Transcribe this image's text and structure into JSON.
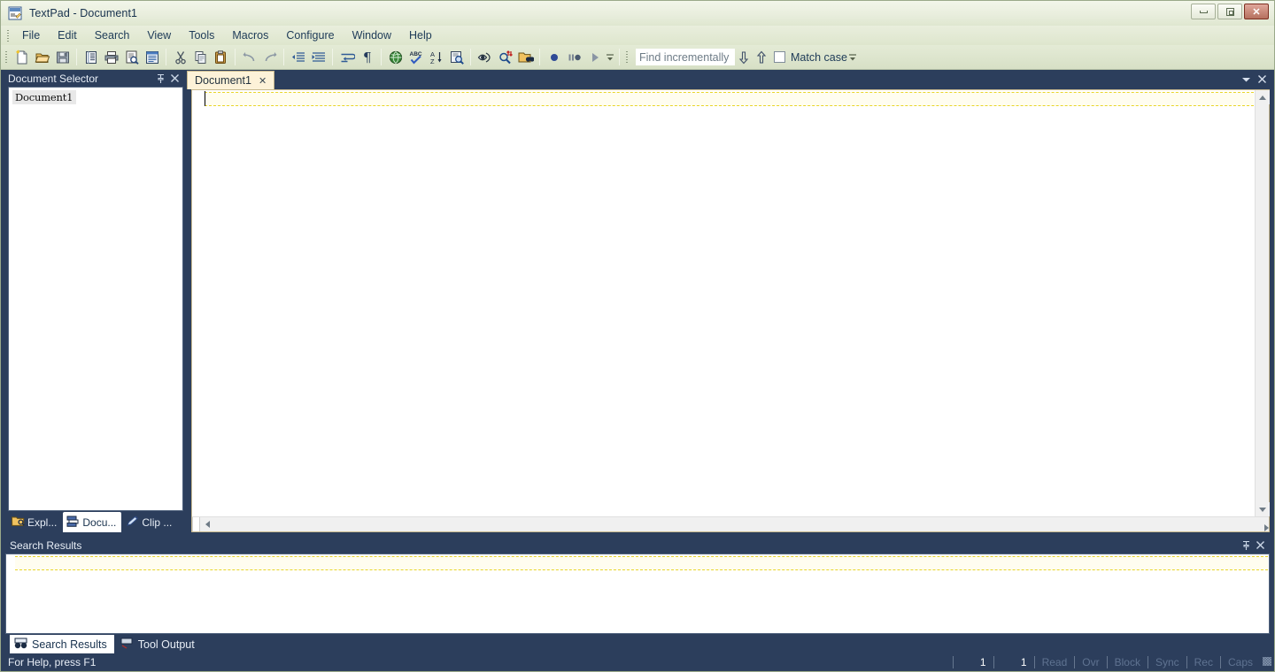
{
  "window": {
    "title": "TextPad - Document1",
    "app_icon": "textpad-app-icon",
    "controls": {
      "minimize": "minimize-button",
      "restore": "restore-button",
      "close_label": "✕"
    }
  },
  "menubar": {
    "items": [
      {
        "label": "File"
      },
      {
        "label": "Edit"
      },
      {
        "label": "Search"
      },
      {
        "label": "View"
      },
      {
        "label": "Tools"
      },
      {
        "label": "Macros"
      },
      {
        "label": "Configure"
      },
      {
        "label": "Window"
      },
      {
        "label": "Help"
      }
    ]
  },
  "toolbar": {
    "buttons": [
      {
        "name": "new-document-icon"
      },
      {
        "name": "open-file-icon"
      },
      {
        "name": "save-file-icon"
      },
      {
        "name": "separator"
      },
      {
        "name": "document-properties-icon"
      },
      {
        "name": "print-icon"
      },
      {
        "name": "print-preview-icon"
      },
      {
        "name": "page-setup-icon"
      },
      {
        "name": "separator"
      },
      {
        "name": "cut-icon"
      },
      {
        "name": "copy-icon"
      },
      {
        "name": "paste-icon"
      },
      {
        "name": "separator"
      },
      {
        "name": "undo-icon"
      },
      {
        "name": "redo-icon"
      },
      {
        "name": "separator"
      },
      {
        "name": "decrease-indent-icon"
      },
      {
        "name": "increase-indent-icon"
      },
      {
        "name": "separator"
      },
      {
        "name": "word-wrap-icon"
      },
      {
        "name": "show-paragraphs-icon"
      },
      {
        "name": "separator"
      },
      {
        "name": "web-browse-icon"
      },
      {
        "name": "spell-check-icon"
      },
      {
        "name": "sort-lines-icon"
      },
      {
        "name": "find-in-files-icon"
      },
      {
        "name": "separator"
      },
      {
        "name": "view-document-icon"
      },
      {
        "name": "replace-icon"
      },
      {
        "name": "search-folder-icon"
      },
      {
        "name": "separator"
      },
      {
        "name": "record-macro-icon"
      },
      {
        "name": "pause-macro-icon"
      },
      {
        "name": "play-macro-icon"
      }
    ],
    "find": {
      "placeholder": "Find incrementally",
      "value": "",
      "find_next_icon": "arrow-down-icon",
      "find_prev_icon": "arrow-up-icon",
      "match_case_label": "Match case",
      "match_case_checked": false
    },
    "overflow_label": "⏷"
  },
  "document_selector": {
    "title": "Document Selector",
    "pin_icon": "pin-icon",
    "close_icon": "close-icon",
    "items": [
      {
        "label": "Document1"
      }
    ],
    "tabs": [
      {
        "label": "Expl...",
        "icon": "explorer-folder-icon",
        "active": false
      },
      {
        "label": "Docu...",
        "icon": "document-selector-icon",
        "active": true
      },
      {
        "label": "Clip ...",
        "icon": "clip-library-icon",
        "active": false
      }
    ]
  },
  "editor": {
    "tabs": [
      {
        "label": "Document1",
        "close_label": "✕",
        "active": true
      }
    ],
    "tab_menu_icon": "chevron-down-icon",
    "tab_close_icon": "close-icon",
    "content": "",
    "scroll": {
      "up_icon": "scroll-up-arrow",
      "down_icon": "scroll-down-arrow",
      "left_icon": "scroll-left-arrow",
      "right_icon": "scroll-right-arrow"
    }
  },
  "search_results": {
    "title": "Search Results",
    "pin_icon": "pin-icon",
    "close_icon": "close-icon",
    "content": "",
    "tabs": [
      {
        "label": "Search Results",
        "icon": "binoculars-icon",
        "active": true
      },
      {
        "label": "Tool Output",
        "icon": "tool-output-icon",
        "active": false
      }
    ]
  },
  "statusbar": {
    "help_text": "For Help, press F1",
    "line": "1",
    "column": "1",
    "indicators": [
      {
        "label": "Read",
        "active": false
      },
      {
        "label": "Ovr",
        "active": false
      },
      {
        "label": "Block",
        "active": false
      },
      {
        "label": "Sync",
        "active": false
      },
      {
        "label": "Rec",
        "active": false
      },
      {
        "label": "Caps",
        "active": false
      }
    ],
    "resize_grip": "resize-grip-icon"
  },
  "colors": {
    "dock_bg": "#2c3e5c",
    "titlebar_text": "#17314d",
    "tab_active_bg": "#fdf2d8",
    "current_line_border": "#e8d52a",
    "close_button": "#b5705e"
  }
}
